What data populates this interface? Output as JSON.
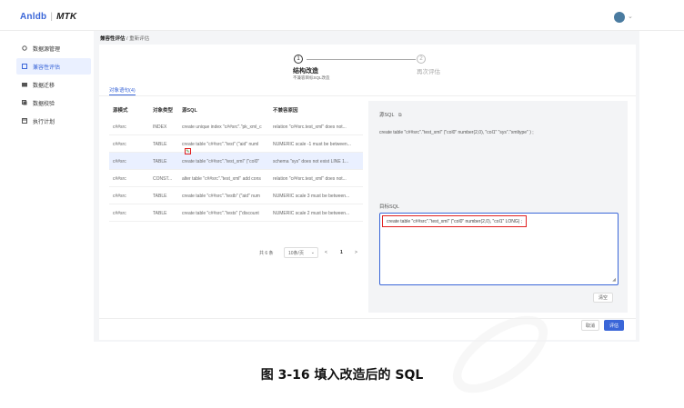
{
  "logo": {
    "brand": "Anldb",
    "product": "MTK"
  },
  "sidebar": {
    "items": [
      {
        "label": "数据源管理"
      },
      {
        "label": "兼容性评估"
      },
      {
        "label": "数据迁移"
      },
      {
        "label": "数据校验"
      },
      {
        "label": "执行计划"
      }
    ]
  },
  "breadcrumb": {
    "parent": "兼容性评估",
    "current": "重新评估"
  },
  "steps": {
    "s1_num": "1",
    "s1_title": "结构改造",
    "s1_desc": "不兼容目标SQL改造",
    "s2_num": "2",
    "s2_title": "再次评估"
  },
  "tab": {
    "label": "对象语句(4)"
  },
  "table": {
    "headers": [
      "源模式",
      "对象类型",
      "源SQL",
      "不兼容原因"
    ],
    "rows": [
      [
        "c##src",
        "INDEX",
        "create unique index \"c##src\".\"pk_xml_c",
        "relation \"c##src.test_xml\" does not..."
      ],
      [
        "c##src",
        "TABLE",
        "create table \"c##src\".\"test\" (\"aid\" numl",
        "NUMERIC scale -1 must be between..."
      ],
      [
        "c##src",
        "TABLE",
        "create table \"c##src\".\"test_xml\" (\"col0\"",
        "schema \"sys\" does not exist LINE 1..."
      ],
      [
        "c##src",
        "CONST...",
        "alter table \"c##src\".\"test_xml\" add cons",
        "relation \"c##src.test_xml\" does not..."
      ],
      [
        "c##src",
        "TABLE",
        "create table \"c##src\".\"testb\" (\"aid\" num",
        "NUMERIC scale 3 must be between..."
      ],
      [
        "c##src",
        "TABLE",
        "create table \"c##src\".\"tests\" (\"discount",
        "NUMERIC scale 2 must be between..."
      ]
    ]
  },
  "pager": {
    "total": "共 6 条",
    "size": "10条/页",
    "prev": "<",
    "page": "1",
    "next": ">"
  },
  "sql": {
    "src_label": "源SQL",
    "src_sql": "create table \"c##src\".\"test_xml\" (\"col0\" number(2,0), \"col1\" \"sys\".\"xmltype\" ) ;",
    "tgt_label": "目标SQL",
    "tgt_sql": "create table \"c##src\".\"test_xml\" (\"col0\" number(2,0), \"col1\" LONG) ;",
    "clear": "清空"
  },
  "footer": {
    "cancel": "取消",
    "ok": "评估"
  },
  "caption": "图 3-16 填入改造后的 SQL",
  "colors": {
    "accent": "#3a66d8",
    "highlight": "#e02020"
  }
}
